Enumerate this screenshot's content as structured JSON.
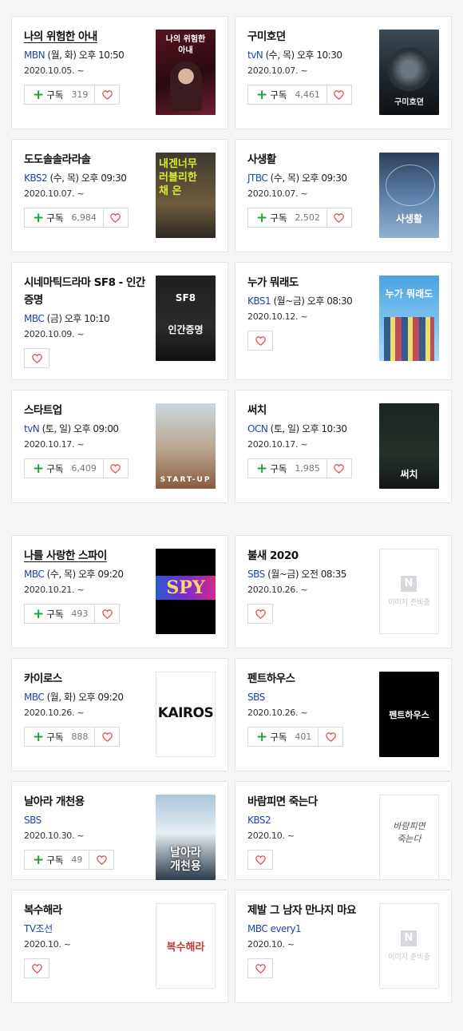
{
  "sections": [
    {
      "cards": [
        {
          "title": "나의 위험한 아내",
          "underline": true,
          "channel": "MBN",
          "schedule": "(월, 화) 오후 10:50",
          "date": "2020.10.05. ~",
          "subscribe_label": "구독",
          "subscribers": "319",
          "poster": {
            "text": "나의 위험한\n아내",
            "style": "p-wife"
          }
        },
        {
          "title": "구미호뎐",
          "underline": false,
          "channel": "tvN",
          "schedule": "(수, 목) 오후 10:30",
          "date": "2020.10.07. ~",
          "subscribe_label": "구독",
          "subscribers": "4,461",
          "poster": {
            "text": "구미호뎐",
            "style": "p-gumiho"
          }
        },
        {
          "title": "도도솔솔라라솔",
          "underline": false,
          "channel": "KBS2",
          "schedule": "(수, 목) 오후 09:30",
          "date": "2020.10.07. ~",
          "subscribe_label": "구독",
          "subscribers": "6,984",
          "poster": {
            "text": "내겐너무\n러블리한\n채 은",
            "style": "p-dodo"
          }
        },
        {
          "title": "사생활",
          "underline": false,
          "channel": "JTBC",
          "schedule": "(수, 목) 오후 09:30",
          "date": "2020.10.07. ~",
          "subscribe_label": "구독",
          "subscribers": "2,502",
          "poster": {
            "text": "사생활",
            "style": "p-private"
          }
        },
        {
          "title": "시네마틱드라마 SF8 - 인간증명",
          "underline": false,
          "channel": "MBC",
          "schedule": "(금) 오후 10:10",
          "date": "2020.10.09. ~",
          "subscribe_label": "",
          "subscribers": "",
          "poster": {
            "text": "SF8\n인간증명",
            "style": "p-sf8"
          }
        },
        {
          "title": "누가 뭐래도",
          "underline": false,
          "channel": "KBS1",
          "schedule": "(월~금) 오후 08:30",
          "date": "2020.10.12. ~",
          "subscribe_label": "",
          "subscribers": "",
          "poster": {
            "text": "누가 뭐래도",
            "style": "p-nuga"
          }
        },
        {
          "title": "스타트업",
          "underline": false,
          "channel": "tvN",
          "schedule": "(토, 일) 오후 09:00",
          "date": "2020.10.17. ~",
          "subscribe_label": "구독",
          "subscribers": "6,409",
          "poster": {
            "text": "START-UP",
            "style": "p-start"
          }
        },
        {
          "title": "써치",
          "underline": false,
          "channel": "OCN",
          "schedule": "(토, 일) 오후 10:30",
          "date": "2020.10.17. ~",
          "subscribe_label": "구독",
          "subscribers": "1,985",
          "poster": {
            "text": "써치",
            "style": "p-search"
          }
        }
      ]
    },
    {
      "cards": [
        {
          "title": "나를 사랑한 스파이",
          "underline": true,
          "channel": "MBC",
          "schedule": "(수, 목) 오후 09:20",
          "date": "2020.10.21. ~",
          "subscribe_label": "구독",
          "subscribers": "493",
          "poster": {
            "text": "SPY",
            "style": "p-spy"
          }
        },
        {
          "title": "불새 2020",
          "underline": false,
          "channel": "SBS",
          "schedule": "(월~금) 오전 08:35",
          "date": "2020.10.26. ~",
          "subscribe_label": "",
          "subscribers": "",
          "poster": {
            "text": "이미지 준비중",
            "style": "p-none"
          }
        },
        {
          "title": "카이로스",
          "underline": false,
          "channel": "MBC",
          "schedule": "(월, 화) 오후 09:20",
          "date": "2020.10.26. ~",
          "subscribe_label": "구독",
          "subscribers": "888",
          "poster": {
            "text": "KAIROS",
            "style": "p-kairos"
          }
        },
        {
          "title": "펜트하우스",
          "underline": false,
          "channel": "SBS",
          "schedule": "",
          "date": "2020.10.26. ~",
          "subscribe_label": "구독",
          "subscribers": "401",
          "poster": {
            "text": "펜트하우스",
            "style": "p-pent"
          }
        },
        {
          "title": "날아라 개천용",
          "underline": false,
          "channel": "SBS",
          "schedule": "",
          "date": "2020.10.30. ~",
          "subscribe_label": "구독",
          "subscribers": "49",
          "poster": {
            "text": "날아라\n개천용",
            "style": "p-dragon"
          }
        },
        {
          "title": "바람피면 죽는다",
          "underline": false,
          "channel": "KBS2",
          "schedule": "",
          "date": "2020.10. ~",
          "subscribe_label": "",
          "subscribers": "",
          "poster": {
            "text": "바람피면\n죽는다",
            "style": "p-wind"
          }
        },
        {
          "title": "복수해라",
          "underline": false,
          "channel": "TV조선",
          "schedule": "",
          "date": "2020.10. ~",
          "subscribe_label": "",
          "subscribers": "",
          "poster": {
            "text": "복수해라",
            "style": "p-revenge"
          }
        },
        {
          "title": "제발 그 남자 만나지 마요",
          "underline": false,
          "channel": "MBC every1",
          "schedule": "",
          "date": "2020.10. ~",
          "subscribe_label": "",
          "subscribers": "",
          "poster": {
            "text": "이미지 준비중",
            "style": "p-none"
          }
        }
      ]
    }
  ],
  "colors": {
    "accent_green": "#1aa53a",
    "channel_blue": "#1e47a8",
    "heart_red": "#e8414b"
  }
}
